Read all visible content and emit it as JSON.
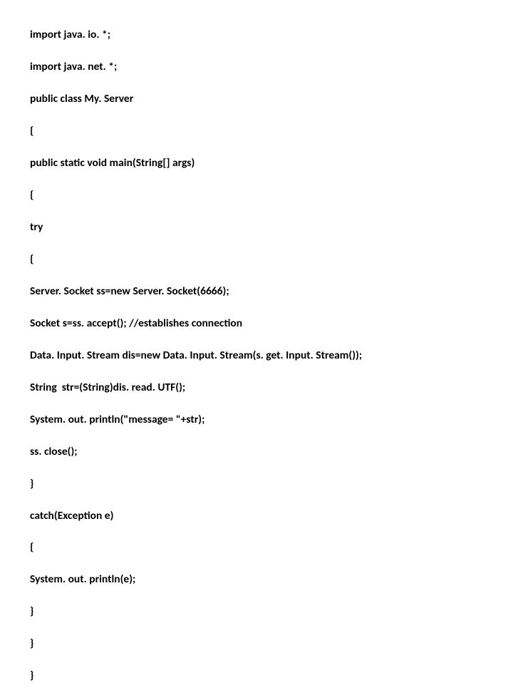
{
  "code": {
    "lines": [
      "import java. io. *;",
      "import java. net. *;",
      "public class My. Server",
      "{",
      "public static void main(String[] args)",
      "{",
      "try",
      "{",
      "Server. Socket ss=new Server. Socket(6666);",
      "Socket s=ss. accept(); //establishes connection",
      "Data. Input. Stream dis=new Data. Input. Stream(s. get. Input. Stream());",
      "String  str=(String)dis. read. UTF();",
      "System. out. println(\"message= \"+str);",
      "ss. close();",
      "}",
      "catch(Exception e)",
      "{",
      "System. out. println(e);",
      "}",
      "}",
      "}"
    ]
  }
}
